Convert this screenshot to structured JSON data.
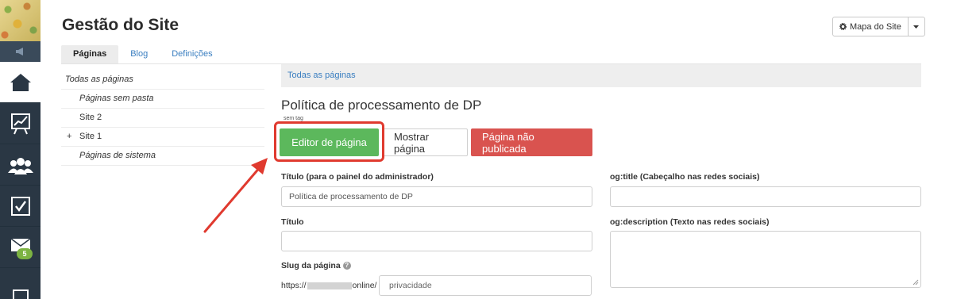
{
  "header": {
    "title": "Gestão do Site"
  },
  "sitemap_button": {
    "label": "Mapa do Site"
  },
  "tabs": [
    {
      "label": "Páginas"
    },
    {
      "label": "Blog"
    },
    {
      "label": "Definições"
    }
  ],
  "tree": {
    "root": "Todas as páginas",
    "items": [
      {
        "label": "Páginas sem pasta"
      },
      {
        "label": "Site 2"
      },
      {
        "label": "Site 1",
        "prefix": "+"
      },
      {
        "label": "Páginas de sistema"
      }
    ]
  },
  "breadcrumb": "Todas as páginas",
  "page": {
    "title": "Política de processamento de DP",
    "tag": "sem tag"
  },
  "buttons": {
    "editor": "Editor de página",
    "show": "Mostrar página",
    "unpublished": "Página não publicada"
  },
  "form": {
    "admin_title_label": "Título (para o painel do administrador)",
    "admin_title_value": "Política de processamento de DP",
    "title_label": "Título",
    "title_value": "",
    "slug_label": "Slug da página",
    "slug_prefix_start": "https://",
    "slug_prefix_end": "online/",
    "slug_value": "privacidade",
    "og_title_label": "og:title (Cabeçalho nas redes sociais)",
    "og_title_value": "",
    "og_description_label": "og:description (Texto nas redes sociais)"
  },
  "notifications": {
    "mail_count": "5"
  },
  "colors": {
    "accent": "#3a7ec0",
    "success": "#5cb85c",
    "danger": "#d9534f",
    "highlight": "#e03a2f",
    "sidebar": "#2a3744"
  }
}
